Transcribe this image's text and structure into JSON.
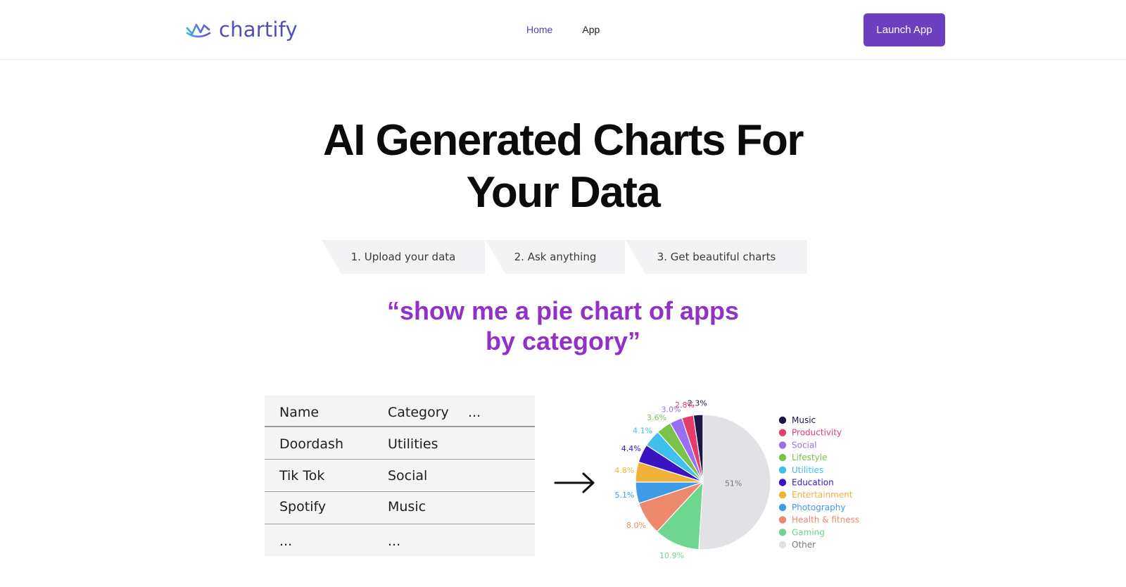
{
  "header": {
    "brand": "chartify",
    "nav": {
      "home": "Home",
      "app": "App"
    },
    "cta": "Launch App",
    "colors": {
      "brand": "#4f4fb9",
      "cta_bg": "#6b3fc0",
      "nav_active": "#4e43b8"
    }
  },
  "hero": {
    "title_line1": "AI Generated Charts For",
    "title_line2": "Your Data"
  },
  "steps": [
    "1. Upload your data",
    "2. Ask anything",
    "3. Get beautiful charts"
  ],
  "prompt": {
    "line1": "“show me a pie chart of apps",
    "line2": "by category”",
    "color": "#9131c6"
  },
  "table": {
    "headers": [
      "Name",
      "Category",
      "..."
    ],
    "rows": [
      [
        "Doordash",
        "Utilities"
      ],
      [
        "Tik Tok",
        "Social"
      ],
      [
        "Spotify",
        "Music"
      ],
      [
        "...",
        "..."
      ]
    ]
  },
  "arrow_icon": "right-arrow-icon",
  "chart_data": {
    "type": "pie",
    "slices": [
      {
        "label": "Music",
        "value": 2.3,
        "display": "2.3%",
        "color": "#1c1645"
      },
      {
        "label": "Productivity",
        "value": 2.8,
        "display": "2.8%",
        "color": "#e33d6b"
      },
      {
        "label": "Social",
        "value": 3.0,
        "display": "3.0%",
        "color": "#9a6ef0"
      },
      {
        "label": "Lifestyle",
        "value": 3.6,
        "display": "3.6%",
        "color": "#7ac34a"
      },
      {
        "label": "Utilities",
        "value": 4.1,
        "display": "4.1%",
        "color": "#3fbfee"
      },
      {
        "label": "Education",
        "value": 4.4,
        "display": "4.4%",
        "color": "#3a13c2"
      },
      {
        "label": "Entertainment",
        "value": 4.8,
        "display": "4.8%",
        "color": "#f2b13b"
      },
      {
        "label": "Photography",
        "value": 5.1,
        "display": "5.1%",
        "color": "#3f9be6"
      },
      {
        "label": "Health & fitness",
        "value": 8.0,
        "display": "8.0%",
        "color": "#ed8a6d"
      },
      {
        "label": "Gaming",
        "value": 10.9,
        "display": "10.9%",
        "color": "#6fd690"
      },
      {
        "label": "Other",
        "value": 51,
        "display": "51%",
        "color": "#e2e1e6"
      }
    ],
    "legend_position": "right"
  }
}
